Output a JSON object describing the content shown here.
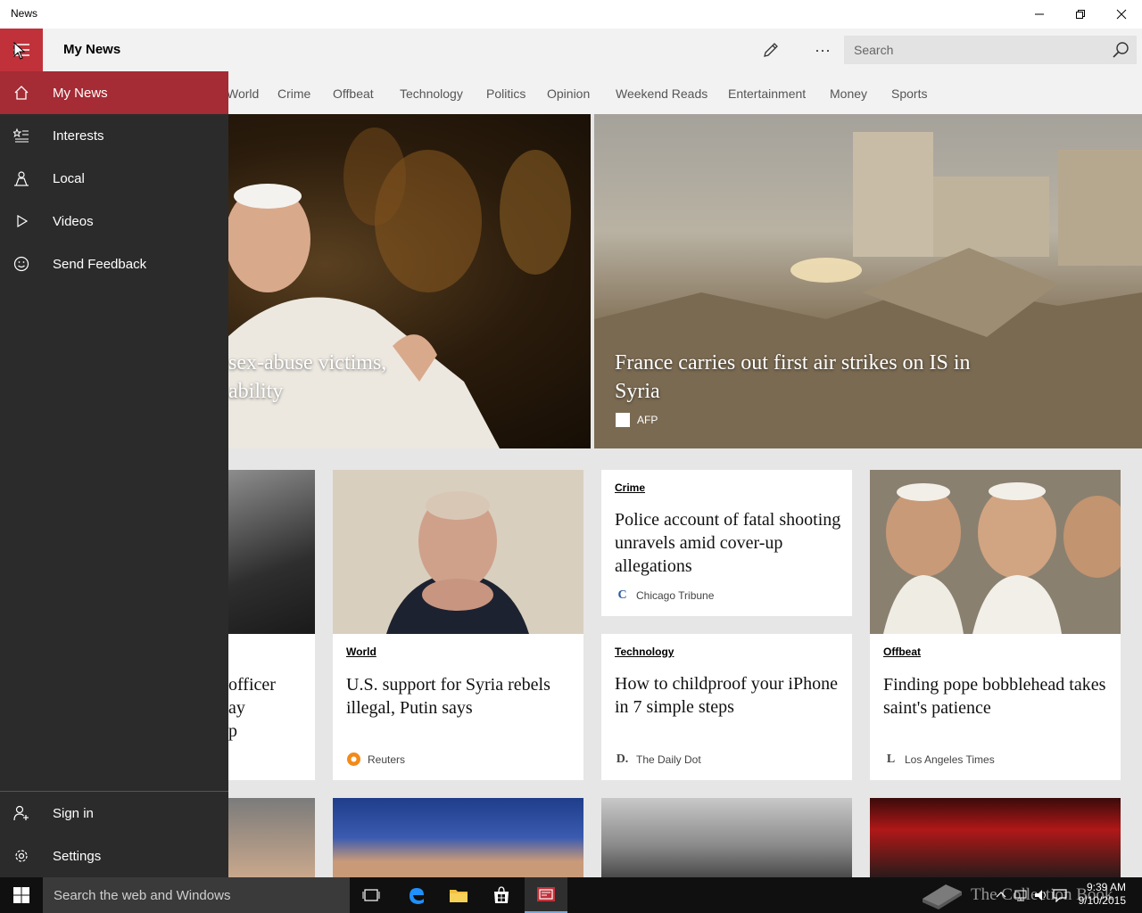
{
  "window": {
    "title": "News"
  },
  "header": {
    "title": "My News",
    "search_placeholder": "Search",
    "more_label": "···"
  },
  "categories": [
    "World",
    "Crime",
    "Offbeat",
    "Technology",
    "Politics",
    "Opinion",
    "Weekend Reads",
    "Entertainment",
    "Money",
    "Sports"
  ],
  "nav": {
    "items": [
      {
        "label": "My News",
        "icon": "home-icon"
      },
      {
        "label": "Interests",
        "icon": "interests-icon"
      },
      {
        "label": "Local",
        "icon": "local-icon"
      },
      {
        "label": "Videos",
        "icon": "play-icon"
      },
      {
        "label": "Send Feedback",
        "icon": "smiley-icon"
      }
    ],
    "bottom": [
      {
        "label": "Sign in",
        "icon": "add-person-icon"
      },
      {
        "label": "Settings",
        "icon": "gear-icon"
      }
    ]
  },
  "hero": {
    "left": {
      "headline_line1": "sex-abuse victims,",
      "headline_line2": "ability"
    },
    "right": {
      "headline": "France carries out first air strikes on IS in Syria",
      "source": "AFP"
    }
  },
  "cards": {
    "partial": {
      "title_line1": "officer",
      "title_line2": "ay",
      "title_line3": "p"
    },
    "putin": {
      "category": "World",
      "title": "U.S. support for Syria rebels illegal, Putin says",
      "source": "Reuters"
    },
    "police": {
      "category": "Crime",
      "title": "Police account of fatal shooting unravels amid cover-up allegations",
      "source": "Chicago Tribune"
    },
    "iphone": {
      "category": "Technology",
      "title": "How to childproof your iPhone in 7 simple steps",
      "source": "The Daily Dot"
    },
    "pope": {
      "category": "Offbeat",
      "title": "Finding pope bobblehead takes saint's patience",
      "source": "Los Angeles Times"
    }
  },
  "taskbar": {
    "search_placeholder": "Search the web and Windows",
    "time": "9:39 AM",
    "date": "9/10/2015",
    "watermark": "The Collection Book"
  },
  "colors": {
    "accent": "#c1313a",
    "nav_active": "#a52b34",
    "nav_bg": "#2b2b2b"
  }
}
